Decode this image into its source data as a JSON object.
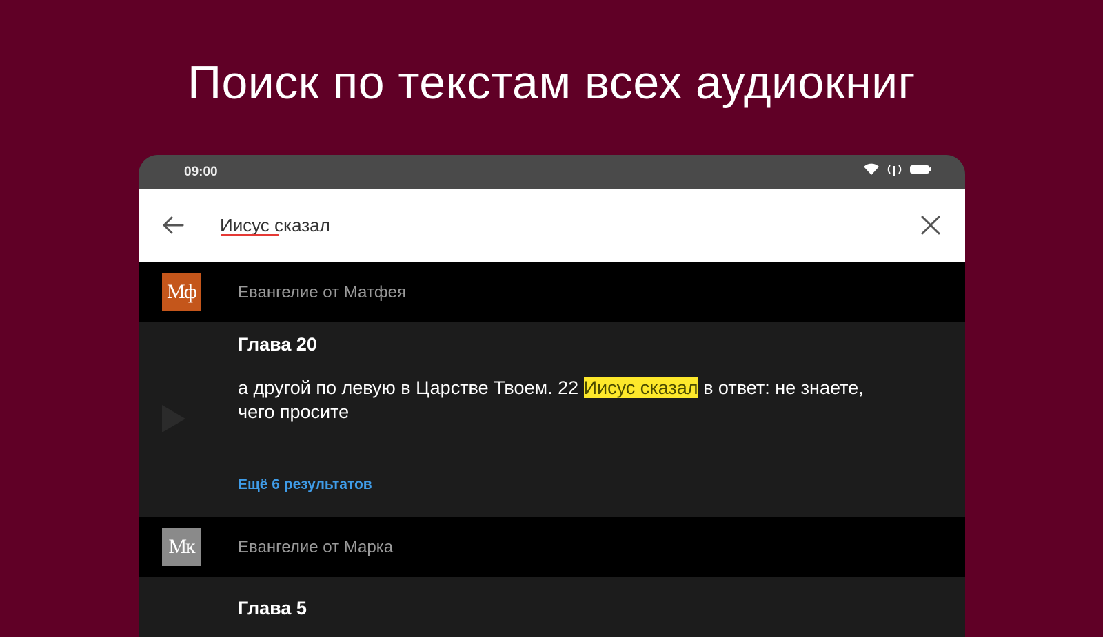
{
  "headline": "Поиск по текстам всех аудиокниг",
  "status_bar": {
    "time": "09:00",
    "icons": [
      "wifi-icon",
      "signal-icon",
      "battery-icon"
    ]
  },
  "search": {
    "query": "Иисус сказал",
    "back_icon": "arrow-left-icon",
    "clear_icon": "close-icon"
  },
  "results": [
    {
      "badge": "Мф",
      "badge_color": "#c4561b",
      "book": "Евангелие от Матфея",
      "chapter": "Глава 20",
      "snippet_before": "а другой по левую в Царстве Твоем. 22 ",
      "snippet_match": "Иисус сказал",
      "snippet_after": " в ответ: не знаете, чего просите",
      "more": "Ещё 6 результатов"
    },
    {
      "badge": "Мк",
      "badge_color": "#8a8a8a",
      "book": "Евангелие от Марка",
      "chapter": "Глава 5"
    }
  ],
  "colors": {
    "background": "#600026",
    "highlight": "#fde82b",
    "link": "#3f9ce8"
  }
}
